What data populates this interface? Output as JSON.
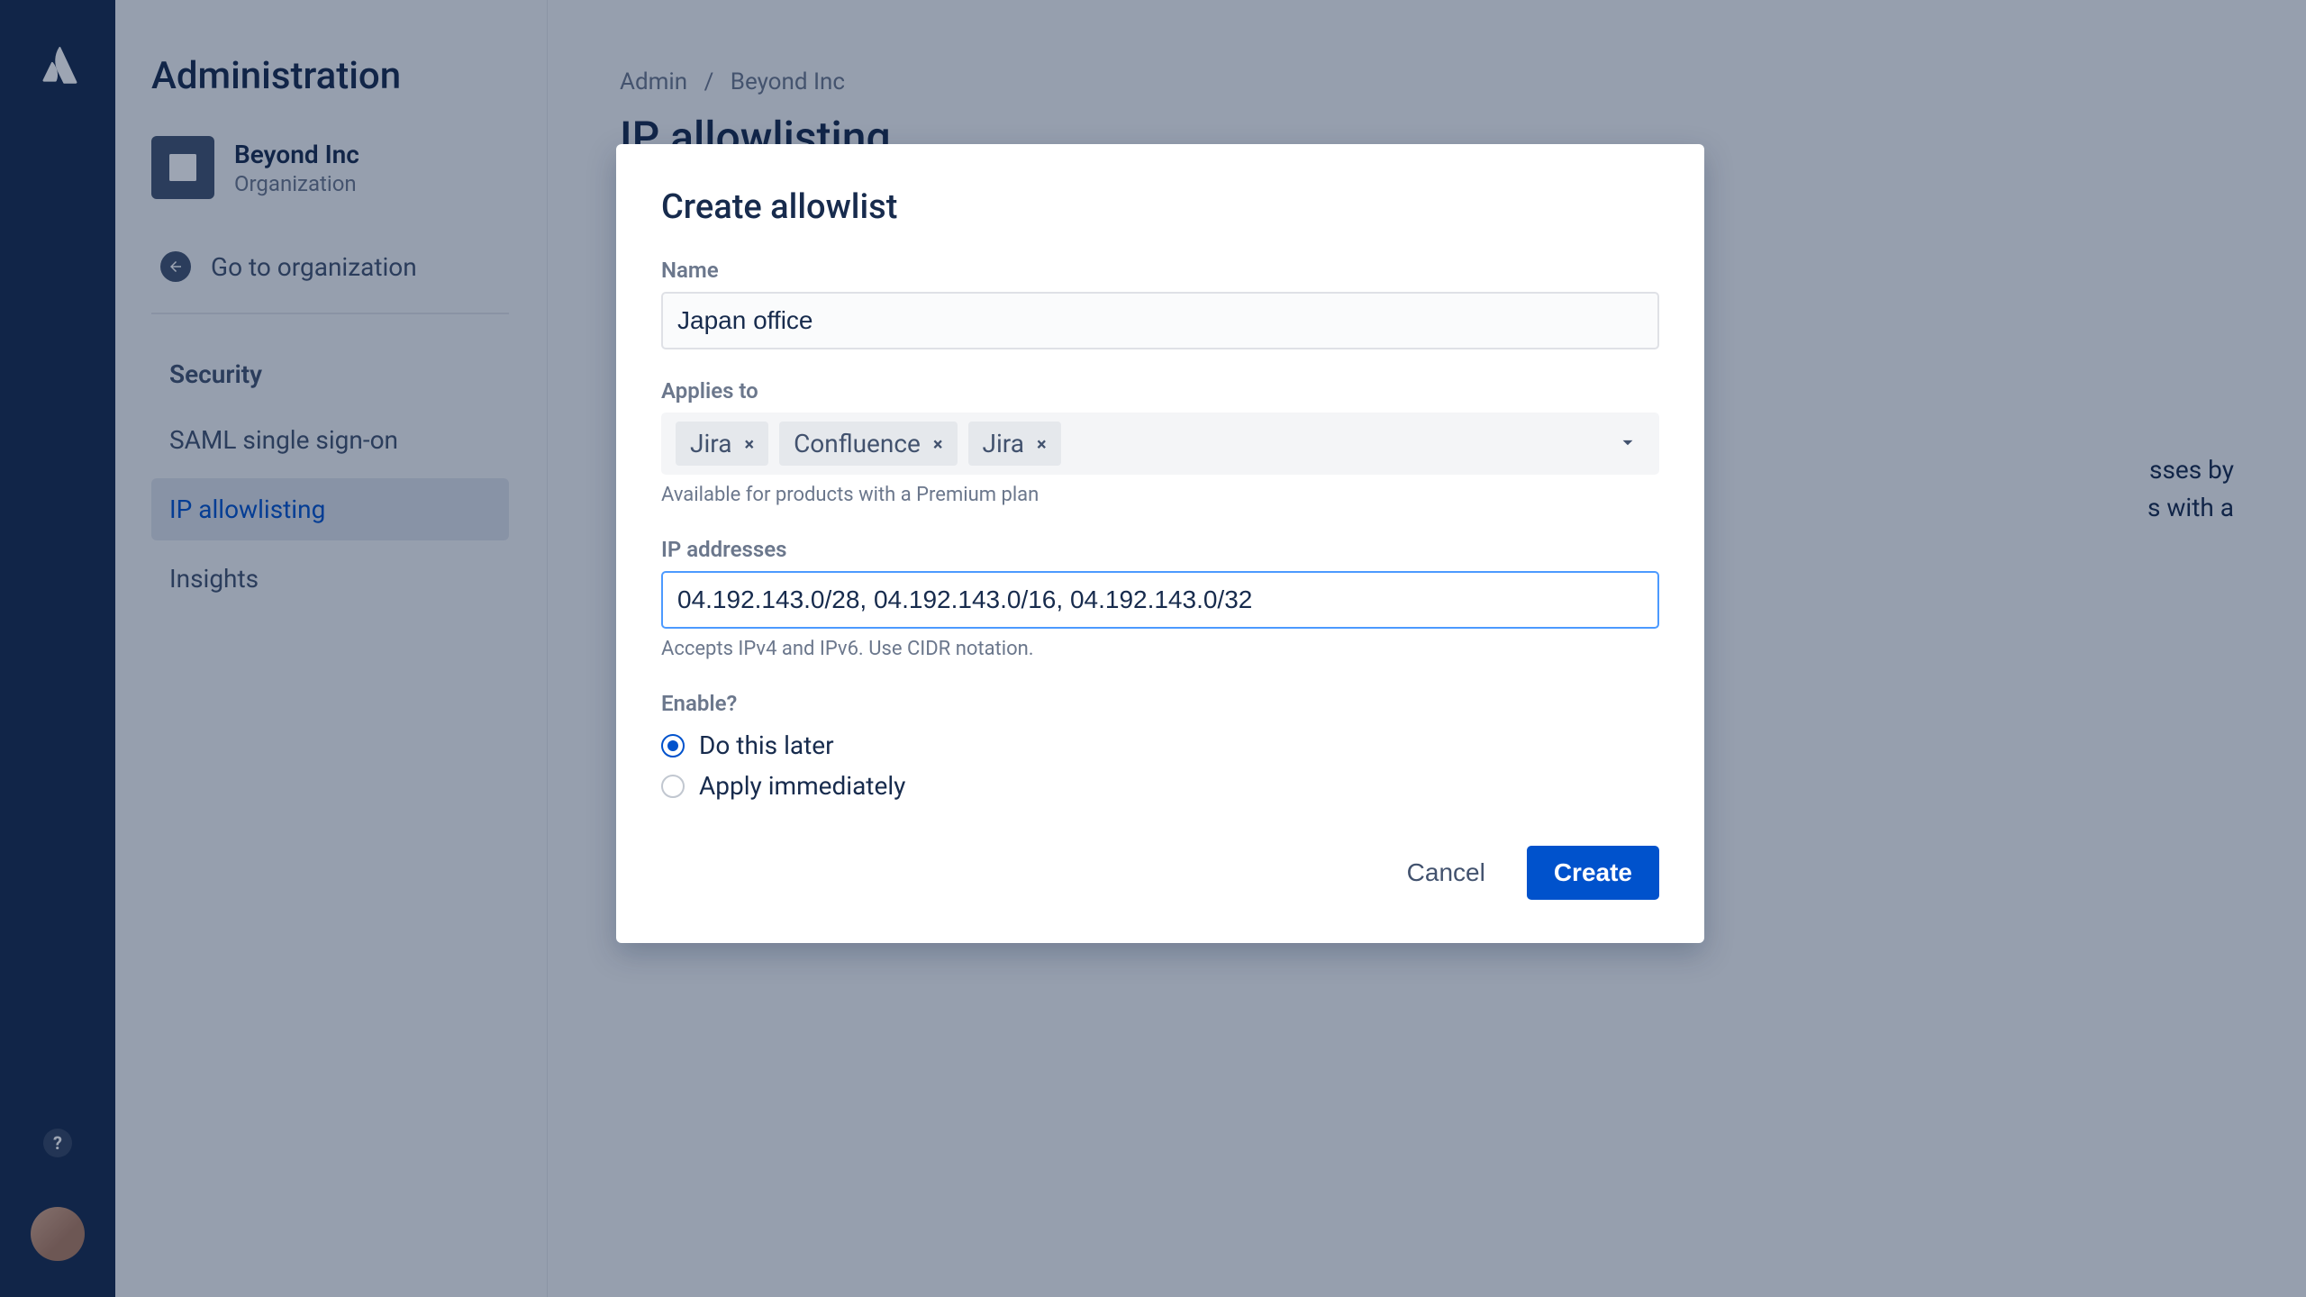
{
  "rail": {
    "help_glyph": "?"
  },
  "sidebar": {
    "title": "Administration",
    "org": {
      "name": "Beyond Inc",
      "subtitle": "Organization"
    },
    "go_link": "Go to organization",
    "section_label": "Security",
    "items": [
      {
        "label": "SAML single sign-on"
      },
      {
        "label": "IP allowlisting"
      },
      {
        "label": "Insights"
      }
    ]
  },
  "main": {
    "breadcrumb": {
      "a": "Admin",
      "sep": "/",
      "b": "Beyond Inc"
    },
    "page_title": "IP allowlisting",
    "desc_partial_1": "sses by",
    "desc_partial_2": "s with a"
  },
  "modal": {
    "title": "Create allowlist",
    "name_label": "Name",
    "name_value": "Japan office",
    "applies_label": "Applies to",
    "tags": [
      "Jira",
      "Confluence",
      "Jira"
    ],
    "applies_help": "Available for products with a Premium plan",
    "ip_label": "IP addresses",
    "ip_value": "04.192.143.0/28, 04.192.143.0/16, 04.192.143.0/32",
    "ip_help": "Accepts IPv4 and IPv6. Use CIDR notation.",
    "enable_label": "Enable?",
    "radio_later": "Do this later",
    "radio_now": "Apply immediately",
    "cancel": "Cancel",
    "create": "Create"
  }
}
